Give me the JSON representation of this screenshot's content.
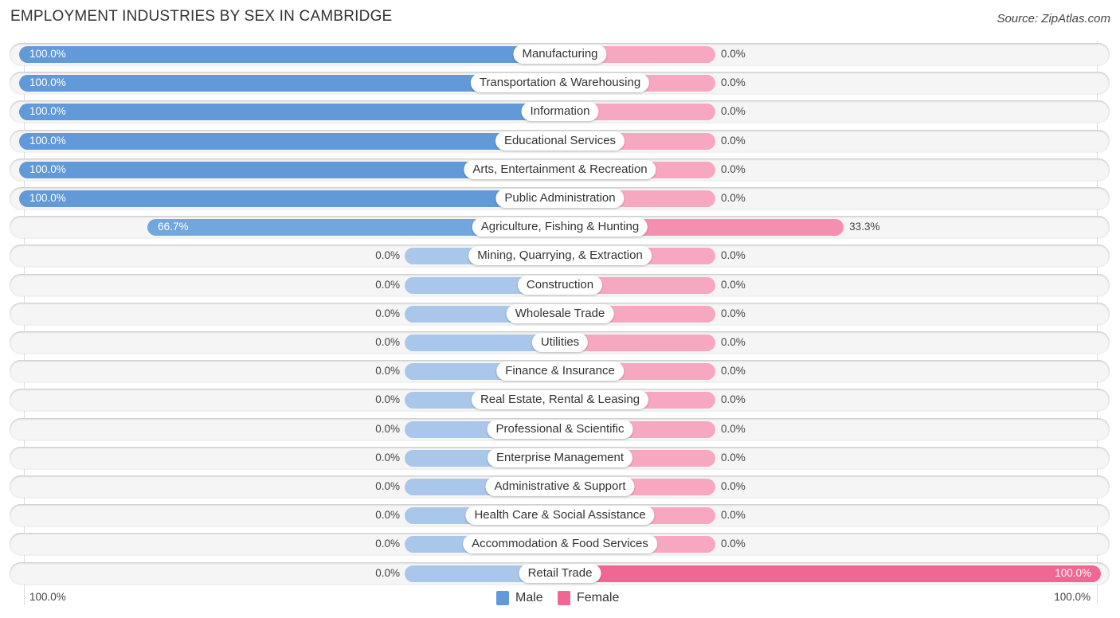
{
  "title": "EMPLOYMENT INDUSTRIES BY SEX IN CAMBRIDGE",
  "source": "Source: ZipAtlas.com",
  "colors": {
    "male_full": "#6199d9",
    "male_light": "#a9c7ea",
    "female_full": "#f06793",
    "female_light": "#f7a7c0",
    "female_mid": "#f48fb0"
  },
  "legend": [
    {
      "name": "Male",
      "color": "#6199d9"
    },
    {
      "name": "Female",
      "color": "#f06793"
    }
  ],
  "axis": {
    "left_label": "100.0%",
    "right_label": "100.0%"
  },
  "chart_data": {
    "type": "bar",
    "orientation": "horizontal-diverging",
    "title": "EMPLOYMENT INDUSTRIES BY SEX IN CAMBRIDGE",
    "xlabel": "",
    "ylabel": "",
    "xlim": [
      -100,
      100
    ],
    "legend_position": "bottom-center",
    "grid": false,
    "categories": [
      "Manufacturing",
      "Transportation & Warehousing",
      "Information",
      "Educational Services",
      "Arts, Entertainment & Recreation",
      "Public Administration",
      "Agriculture, Fishing & Hunting",
      "Mining, Quarrying, & Extraction",
      "Construction",
      "Wholesale Trade",
      "Utilities",
      "Finance & Insurance",
      "Real Estate, Rental & Leasing",
      "Professional & Scientific",
      "Enterprise Management",
      "Administrative & Support",
      "Health Care & Social Assistance",
      "Accommodation & Food Services",
      "Retail Trade"
    ],
    "series": [
      {
        "name": "Male",
        "values": [
          100,
          100,
          100,
          100,
          100,
          100,
          66.7,
          0,
          0,
          0,
          0,
          0,
          0,
          0,
          0,
          0,
          0,
          0,
          0
        ],
        "labels": [
          "100.0%",
          "100.0%",
          "100.0%",
          "100.0%",
          "100.0%",
          "100.0%",
          "66.7%",
          "0.0%",
          "0.0%",
          "0.0%",
          "0.0%",
          "0.0%",
          "0.0%",
          "0.0%",
          "0.0%",
          "0.0%",
          "0.0%",
          "0.0%",
          "0.0%"
        ]
      },
      {
        "name": "Female",
        "values": [
          0,
          0,
          0,
          0,
          0,
          0,
          33.3,
          0,
          0,
          0,
          0,
          0,
          0,
          0,
          0,
          0,
          0,
          0,
          100
        ],
        "labels": [
          "0.0%",
          "0.0%",
          "0.0%",
          "0.0%",
          "0.0%",
          "0.0%",
          "33.3%",
          "0.0%",
          "0.0%",
          "0.0%",
          "0.0%",
          "0.0%",
          "0.0%",
          "0.0%",
          "0.0%",
          "0.0%",
          "0.0%",
          "0.0%",
          "100.0%"
        ]
      }
    ]
  }
}
